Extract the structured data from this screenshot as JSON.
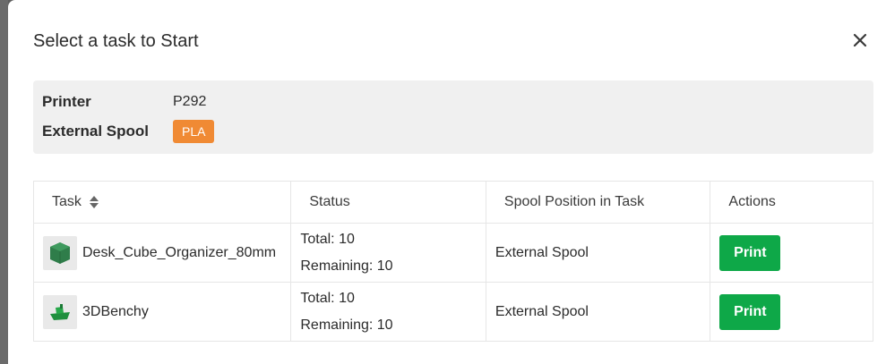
{
  "dialog": {
    "title": "Select a task to Start",
    "close_icon": "close-icon"
  },
  "info": {
    "printer_label": "Printer",
    "printer_value": "P292",
    "spool_label": "External Spool",
    "spool_tag": "PLA",
    "spool_tag_color": "#f08a34"
  },
  "table": {
    "headers": {
      "task": "Task",
      "status": "Status",
      "spool_position": "Spool Position in Task",
      "actions": "Actions"
    },
    "rows": [
      {
        "thumbnail_icon": "cube-model-icon",
        "name": "Desk_Cube_Organizer_80mm",
        "total": "Total: 10",
        "remaining": "Remaining: 10",
        "spool_position": "External Spool",
        "action_label": "Print"
      },
      {
        "thumbnail_icon": "benchy-boat-icon",
        "name": "3DBenchy",
        "total": "Total: 10",
        "remaining": "Remaining: 10",
        "spool_position": "External Spool",
        "action_label": "Print"
      }
    ]
  },
  "colors": {
    "print_button": "#0ea848",
    "info_background": "#f0f0f0"
  }
}
